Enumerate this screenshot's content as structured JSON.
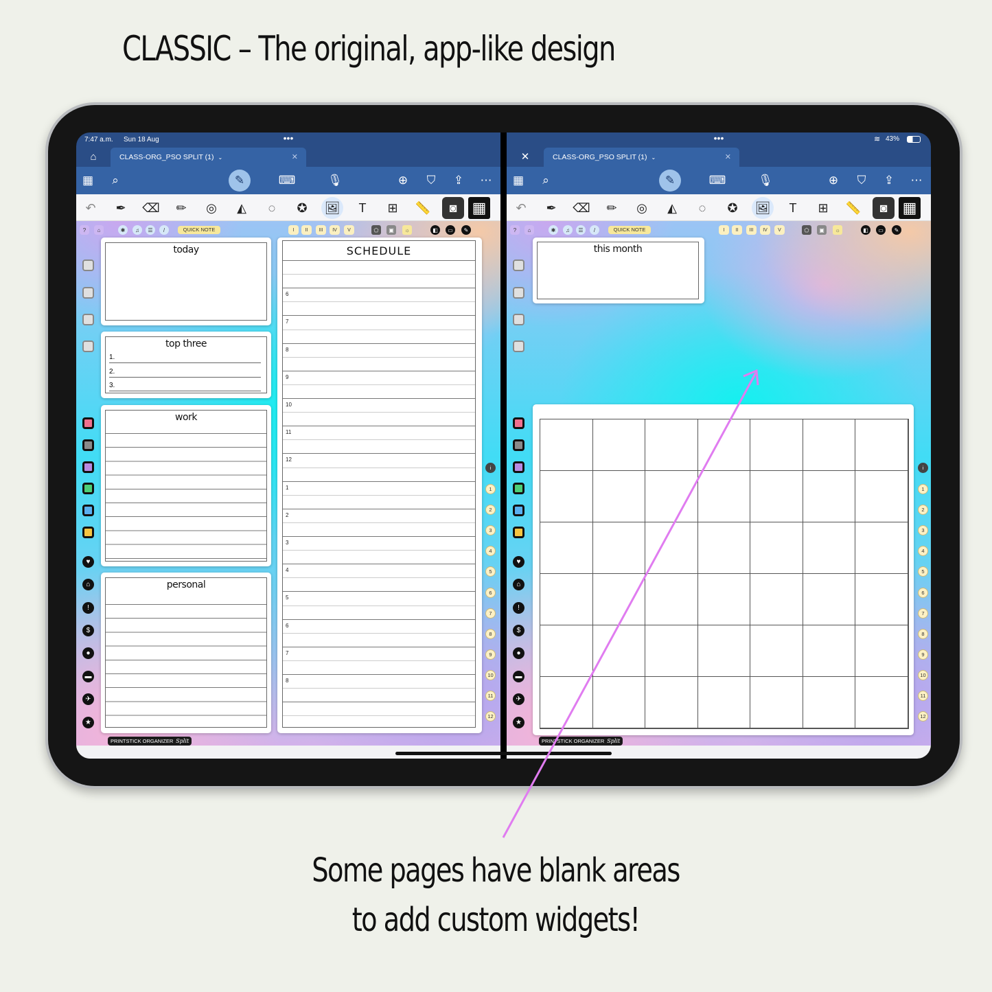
{
  "title": "CLASSIC – The original, app-like design",
  "caption": [
    "Some pages have blank areas",
    "to add custom widgets!"
  ],
  "status": {
    "time": "7:47 a.m.",
    "date": "Sun 18 Aug",
    "battery": "43%",
    "wifi_icon": "wifi-icon",
    "battery_icon": "battery-icon"
  },
  "tab_title": "CLASS-ORG_PSO SPLIT (1)",
  "toolbar": [
    {
      "name": "thumbnails-icon",
      "glyph": "▦"
    },
    {
      "name": "search-icon",
      "glyph": "⌕"
    },
    {
      "name": "pen-mode-icon",
      "glyph": "✎"
    },
    {
      "name": "keyboard-icon",
      "glyph": "⌨"
    },
    {
      "name": "microphone-icon",
      "glyph": "🎙"
    },
    {
      "name": "add-page-icon",
      "glyph": "⊕"
    },
    {
      "name": "bookmark-icon",
      "glyph": "⛉"
    },
    {
      "name": "share-icon",
      "glyph": "⇪"
    },
    {
      "name": "more-icon",
      "glyph": "⋯"
    }
  ],
  "tools": [
    {
      "name": "undo-icon",
      "glyph": "↶"
    },
    {
      "name": "pen-icon",
      "glyph": "✒"
    },
    {
      "name": "eraser-icon",
      "glyph": "⌫"
    },
    {
      "name": "highlighter-icon",
      "glyph": "✏"
    },
    {
      "name": "tape-icon",
      "glyph": "◎"
    },
    {
      "name": "shapes-icon",
      "glyph": "◭"
    },
    {
      "name": "lasso-icon",
      "glyph": "◌"
    },
    {
      "name": "sticker-icon",
      "glyph": "✪"
    },
    {
      "name": "image-icon",
      "glyph": "🖼"
    },
    {
      "name": "text-box-icon",
      "glyph": "T"
    },
    {
      "name": "image-search-icon",
      "glyph": "⊞"
    },
    {
      "name": "ruler-icon",
      "glyph": "📏"
    },
    {
      "name": "camera-icon",
      "glyph": "◙"
    },
    {
      "name": "grid-icon",
      "glyph": "▦"
    }
  ],
  "mini": {
    "quick_note": "QUICK NOTE",
    "roman": [
      "I",
      "II",
      "III",
      "IV",
      "V"
    ]
  },
  "left_page": {
    "today": "today",
    "top_three": {
      "title": "top three",
      "items": [
        "1.",
        "2.",
        "3."
      ]
    },
    "work": "work",
    "personal": "personal",
    "schedule": {
      "title": "SCHEDULE",
      "hours": [
        "6",
        "7",
        "8",
        "9",
        "10",
        "11",
        "12",
        "1",
        "2",
        "3",
        "4",
        "5",
        "6",
        "7",
        "8"
      ]
    }
  },
  "right_page": {
    "this_month": "this month"
  },
  "side_numbers": [
    "i",
    "1",
    "2",
    "3",
    "4",
    "5",
    "6",
    "7",
    "8",
    "9",
    "10",
    "11",
    "12"
  ],
  "side_icons": [
    "heart-icon",
    "home-icon",
    "info-icon",
    "dollar-icon",
    "person-icon",
    "minus-icon",
    "plane-icon",
    "star-icon"
  ],
  "side_glyphs": [
    "♥",
    "⌂",
    "!",
    "$",
    "●",
    "▬",
    "✈",
    "★"
  ],
  "footer": {
    "brand": "PRINTSTICK ORGANIZER",
    "script": "Split"
  },
  "colors": {
    "tabs": [
      "#f0708e",
      "#8a8a8a",
      "#b88ae3",
      "#4ccf78",
      "#5ab0f0",
      "#f5c542"
    ],
    "toolbar": "#3563a5",
    "arrow": "#e07cf0"
  }
}
